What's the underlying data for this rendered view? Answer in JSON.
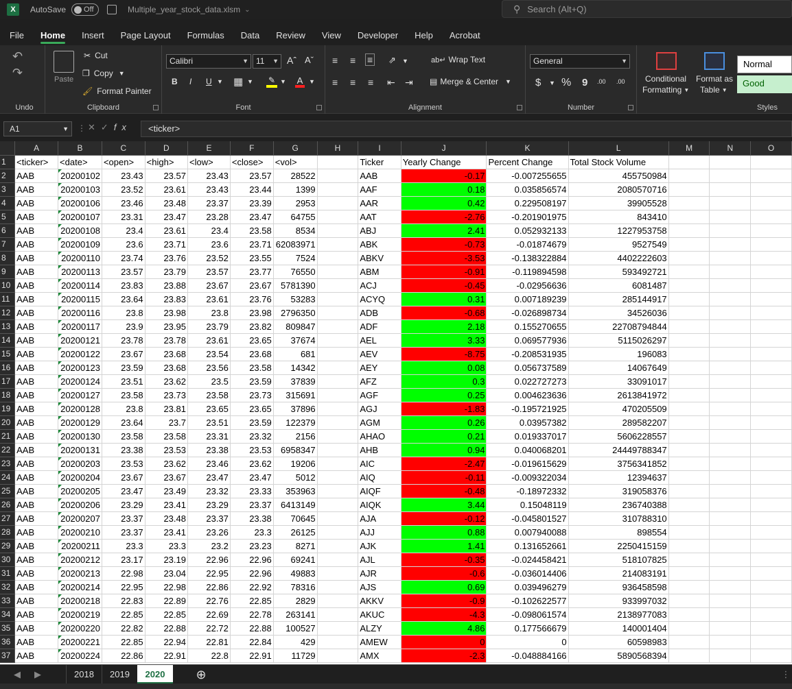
{
  "title": {
    "autosave_label": "AutoSave",
    "autosave_state": "Off",
    "filename": "Multiple_year_stock_data.xlsm",
    "search_placeholder": "Search (Alt+Q)"
  },
  "menu": [
    "File",
    "Home",
    "Insert",
    "Page Layout",
    "Formulas",
    "Data",
    "Review",
    "View",
    "Developer",
    "Help",
    "Acrobat"
  ],
  "ribbon": {
    "undo_label": "Undo",
    "clipboard_label": "Clipboard",
    "paste": "Paste",
    "cut": "Cut",
    "copy": "Copy",
    "format_painter": "Format Painter",
    "font_label": "Font",
    "font_name": "Calibri",
    "font_size": "11",
    "bold": "B",
    "italic": "I",
    "underline": "U",
    "alignment_label": "Alignment",
    "wrap_text": "Wrap Text",
    "merge_center": "Merge & Center",
    "number_label": "Number",
    "number_format": "General",
    "currency": "$",
    "percent": "%",
    "comma": "9",
    "dec_inc": ".00",
    "dec_dec": ".00",
    "cond_format_1": "Conditional",
    "cond_format_2": "Formatting",
    "format_table_1": "Format as",
    "format_table_2": "Table",
    "styles_label": "Styles",
    "style_normal": "Normal",
    "style_good": "Good"
  },
  "formula": {
    "namebox": "A1",
    "content": "<ticker>"
  },
  "columns": [
    "A",
    "B",
    "C",
    "D",
    "E",
    "F",
    "G",
    "H",
    "I",
    "J",
    "K",
    "L",
    "M",
    "N",
    "O"
  ],
  "headers": [
    "<ticker>",
    "<date>",
    "<open>",
    "<high>",
    "<low>",
    "<close>",
    "<vol>",
    "",
    "Ticker",
    "Yearly Change",
    "Percent Change",
    "Total Stock Volume"
  ],
  "rows": [
    [
      "AAB",
      "20200102",
      "23.43",
      "23.57",
      "23.43",
      "23.57",
      "28522",
      "AAB",
      "-0.17",
      "-0.007255655",
      "455750984"
    ],
    [
      "AAB",
      "20200103",
      "23.52",
      "23.61",
      "23.43",
      "23.44",
      "1399",
      "AAF",
      "0.18",
      "0.035856574",
      "2080570716"
    ],
    [
      "AAB",
      "20200106",
      "23.46",
      "23.48",
      "23.37",
      "23.39",
      "2953",
      "AAR",
      "0.42",
      "0.229508197",
      "39905528"
    ],
    [
      "AAB",
      "20200107",
      "23.31",
      "23.47",
      "23.28",
      "23.47",
      "64755",
      "AAT",
      "-2.76",
      "-0.201901975",
      "843410"
    ],
    [
      "AAB",
      "20200108",
      "23.4",
      "23.61",
      "23.4",
      "23.58",
      "8534",
      "ABJ",
      "2.41",
      "0.052932133",
      "1227953758"
    ],
    [
      "AAB",
      "20200109",
      "23.6",
      "23.71",
      "23.6",
      "23.71",
      "62083971",
      "ABK",
      "-0.73",
      "-0.01874679",
      "9527549"
    ],
    [
      "AAB",
      "20200110",
      "23.74",
      "23.76",
      "23.52",
      "23.55",
      "7524",
      "ABKV",
      "-3.53",
      "-0.138322884",
      "4402222603"
    ],
    [
      "AAB",
      "20200113",
      "23.57",
      "23.79",
      "23.57",
      "23.77",
      "76550",
      "ABM",
      "-0.91",
      "-0.119894598",
      "593492721"
    ],
    [
      "AAB",
      "20200114",
      "23.83",
      "23.88",
      "23.67",
      "23.67",
      "5781390",
      "ACJ",
      "-0.45",
      "-0.02956636",
      "6081487"
    ],
    [
      "AAB",
      "20200115",
      "23.64",
      "23.83",
      "23.61",
      "23.76",
      "53283",
      "ACYQ",
      "0.31",
      "0.007189239",
      "285144917"
    ],
    [
      "AAB",
      "20200116",
      "23.8",
      "23.98",
      "23.8",
      "23.98",
      "2796350",
      "ADB",
      "-0.68",
      "-0.026898734",
      "34526036"
    ],
    [
      "AAB",
      "20200117",
      "23.9",
      "23.95",
      "23.79",
      "23.82",
      "809847",
      "ADF",
      "2.18",
      "0.155270655",
      "22708794844"
    ],
    [
      "AAB",
      "20200121",
      "23.78",
      "23.78",
      "23.61",
      "23.65",
      "37674",
      "AEL",
      "3.33",
      "0.069577936",
      "5115026297"
    ],
    [
      "AAB",
      "20200122",
      "23.67",
      "23.68",
      "23.54",
      "23.68",
      "681",
      "AEV",
      "-8.75",
      "-0.208531935",
      "196083"
    ],
    [
      "AAB",
      "20200123",
      "23.59",
      "23.68",
      "23.56",
      "23.58",
      "14342",
      "AEY",
      "0.08",
      "0.056737589",
      "14067649"
    ],
    [
      "AAB",
      "20200124",
      "23.51",
      "23.62",
      "23.5",
      "23.59",
      "37839",
      "AFZ",
      "0.3",
      "0.022727273",
      "33091017"
    ],
    [
      "AAB",
      "20200127",
      "23.58",
      "23.73",
      "23.58",
      "23.73",
      "315691",
      "AGF",
      "0.25",
      "0.004623636",
      "2613841972"
    ],
    [
      "AAB",
      "20200128",
      "23.8",
      "23.81",
      "23.65",
      "23.65",
      "37896",
      "AGJ",
      "-1.83",
      "-0.195721925",
      "470205509"
    ],
    [
      "AAB",
      "20200129",
      "23.64",
      "23.7",
      "23.51",
      "23.59",
      "122379",
      "AGM",
      "0.26",
      "0.03957382",
      "289582207"
    ],
    [
      "AAB",
      "20200130",
      "23.58",
      "23.58",
      "23.31",
      "23.32",
      "2156",
      "AHAO",
      "0.21",
      "0.019337017",
      "5606228557"
    ],
    [
      "AAB",
      "20200131",
      "23.38",
      "23.53",
      "23.38",
      "23.53",
      "6958347",
      "AHB",
      "0.94",
      "0.040068201",
      "24449788347"
    ],
    [
      "AAB",
      "20200203",
      "23.53",
      "23.62",
      "23.46",
      "23.62",
      "19206",
      "AIC",
      "-2.47",
      "-0.019615629",
      "3756341852"
    ],
    [
      "AAB",
      "20200204",
      "23.67",
      "23.67",
      "23.47",
      "23.47",
      "5012",
      "AIQ",
      "-0.11",
      "-0.009322034",
      "12394637"
    ],
    [
      "AAB",
      "20200205",
      "23.47",
      "23.49",
      "23.32",
      "23.33",
      "353963",
      "AIQF",
      "-0.48",
      "-0.18972332",
      "319058376"
    ],
    [
      "AAB",
      "20200206",
      "23.29",
      "23.41",
      "23.29",
      "23.37",
      "6413149",
      "AIQK",
      "3.44",
      "0.15048119",
      "236740388"
    ],
    [
      "AAB",
      "20200207",
      "23.37",
      "23.48",
      "23.37",
      "23.38",
      "70645",
      "AJA",
      "-0.12",
      "-0.045801527",
      "310788310"
    ],
    [
      "AAB",
      "20200210",
      "23.37",
      "23.41",
      "23.26",
      "23.3",
      "26125",
      "AJJ",
      "0.88",
      "0.007940088",
      "898554"
    ],
    [
      "AAB",
      "20200211",
      "23.3",
      "23.3",
      "23.2",
      "23.23",
      "8271",
      "AJK",
      "1.41",
      "0.131652661",
      "2250415159"
    ],
    [
      "AAB",
      "20200212",
      "23.17",
      "23.19",
      "22.96",
      "22.96",
      "69241",
      "AJL",
      "-0.35",
      "-0.024458421",
      "518107825"
    ],
    [
      "AAB",
      "20200213",
      "22.98",
      "23.04",
      "22.95",
      "22.96",
      "49883",
      "AJR",
      "-0.6",
      "-0.036014406",
      "214083191"
    ],
    [
      "AAB",
      "20200214",
      "22.95",
      "22.98",
      "22.86",
      "22.92",
      "78316",
      "AJS",
      "0.69",
      "0.039496279",
      "936458598"
    ],
    [
      "AAB",
      "20200218",
      "22.83",
      "22.89",
      "22.76",
      "22.85",
      "2829",
      "AKKV",
      "-0.9",
      "-0.102622577",
      "933997032"
    ],
    [
      "AAB",
      "20200219",
      "22.85",
      "22.85",
      "22.69",
      "22.78",
      "263141",
      "AKUC",
      "-4.3",
      "-0.098061574",
      "2138977083"
    ],
    [
      "AAB",
      "20200220",
      "22.82",
      "22.88",
      "22.72",
      "22.88",
      "100527",
      "ALZY",
      "4.86",
      "0.177566679",
      "140001404"
    ],
    [
      "AAB",
      "20200221",
      "22.85",
      "22.94",
      "22.81",
      "22.84",
      "429",
      "AMEW",
      "0",
      "0",
      "60598983"
    ],
    [
      "AAB",
      "20200224",
      "22.86",
      "22.91",
      "22.8",
      "22.91",
      "11729",
      "AMX",
      "-2.3",
      "-0.048884166",
      "5890568394"
    ]
  ],
  "sheets": [
    "2018",
    "2019",
    "2020"
  ],
  "active_sheet": "2020",
  "colors": {
    "positive": "#00ff00",
    "negative": "#ff0000",
    "accent": "#1d6f42"
  }
}
